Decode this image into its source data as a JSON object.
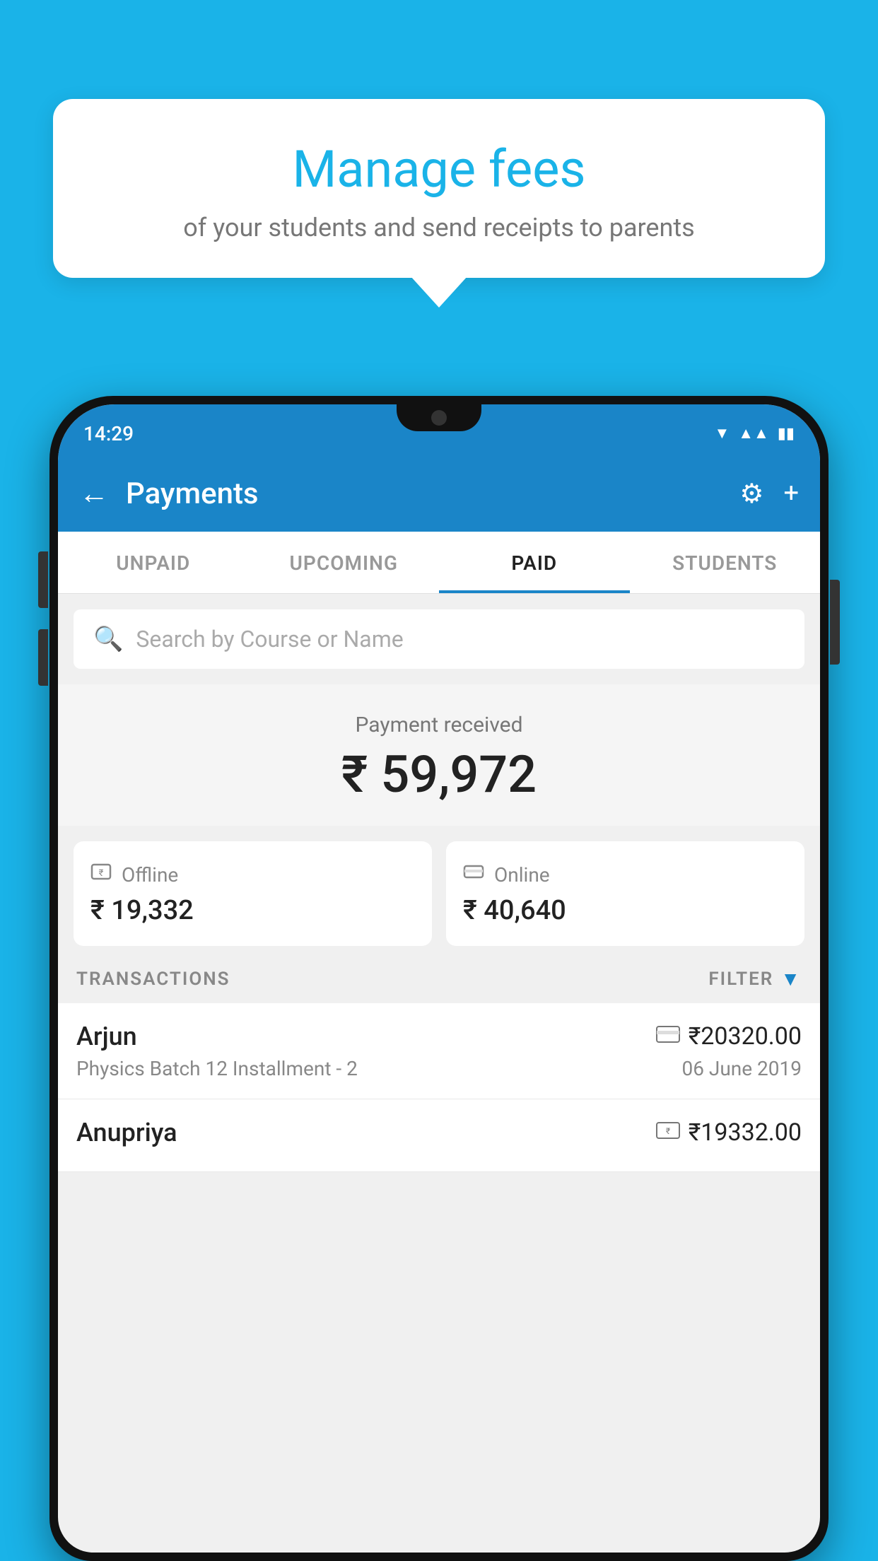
{
  "background_color": "#1ab3e8",
  "tooltip": {
    "title": "Manage fees",
    "subtitle": "of your students and send receipts to parents"
  },
  "status_bar": {
    "time": "14:29",
    "wifi_icon": "▼",
    "signal_icon": "▲",
    "battery_icon": "▮"
  },
  "app_bar": {
    "title": "Payments",
    "back_label": "←",
    "settings_label": "⚙",
    "add_label": "+"
  },
  "tabs": [
    {
      "label": "UNPAID",
      "active": false
    },
    {
      "label": "UPCOMING",
      "active": false
    },
    {
      "label": "PAID",
      "active": true
    },
    {
      "label": "STUDENTS",
      "active": false
    }
  ],
  "search": {
    "placeholder": "Search by Course or Name"
  },
  "payment_received": {
    "label": "Payment received",
    "amount": "₹ 59,972"
  },
  "payment_cards": [
    {
      "type": "Offline",
      "icon": "💳",
      "amount": "₹ 19,332"
    },
    {
      "type": "Online",
      "icon": "💳",
      "amount": "₹ 40,640"
    }
  ],
  "transactions_label": "TRANSACTIONS",
  "filter_label": "FILTER",
  "transactions": [
    {
      "name": "Arjun",
      "description": "Physics Batch 12 Installment - 2",
      "amount": "₹20320.00",
      "date": "06 June 2019",
      "payment_icon": "💳"
    },
    {
      "name": "Anupriya",
      "description": "",
      "amount": "₹19332.00",
      "date": "",
      "payment_icon": "💳"
    }
  ]
}
